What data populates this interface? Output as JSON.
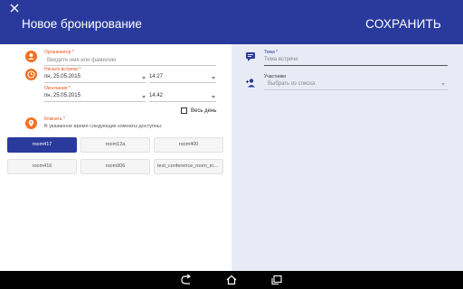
{
  "header": {
    "title": "Новое бронирование",
    "save_label": "СОХРАНИТЬ",
    "close_icon": "close-icon"
  },
  "left": {
    "organizer": {
      "label": "Организатор *",
      "placeholder": "Введите имя или фамилию"
    },
    "start": {
      "label": "Начало встречи *",
      "date": "пн, 25.05.2015",
      "time": "14:27"
    },
    "end": {
      "label": "Окончание *",
      "date": "пн, 25.05.2015",
      "time": "14:42"
    },
    "all_day": {
      "label": "Весь день",
      "checked": false
    },
    "room": {
      "label": "Комната *",
      "hint": "В указанное время следующие комнаты доступны:"
    },
    "rooms": [
      {
        "name": "room417",
        "selected": true
      },
      {
        "name": "room12a",
        "selected": false
      },
      {
        "name": "room400",
        "selected": false
      },
      {
        "name": "room416",
        "selected": false
      },
      {
        "name": "room906",
        "selected": false
      },
      {
        "name": "test_conference_room_in_...",
        "selected": false
      }
    ]
  },
  "right": {
    "topic": {
      "label": "Тема *",
      "placeholder": "Тема встречи"
    },
    "participants": {
      "label": "Участники",
      "placeholder": "Выбрать из списка"
    }
  },
  "colors": {
    "primary": "#2a3a9c",
    "accent": "#f36f21",
    "right_bg": "#e8eaf6"
  },
  "navbar": {
    "icons": [
      "back-icon",
      "home-icon",
      "recents-icon"
    ]
  }
}
